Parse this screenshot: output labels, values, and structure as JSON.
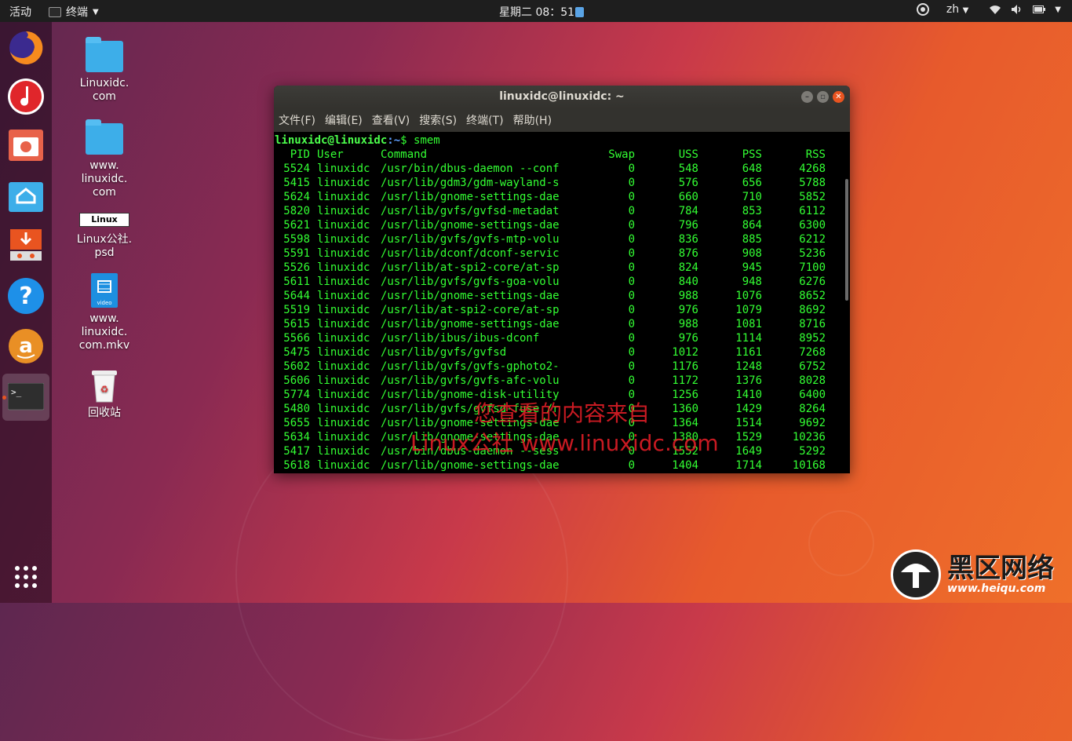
{
  "topbar": {
    "activities": "活动",
    "app_name": "终端",
    "clock": "星期二 08：51",
    "lang": "zh"
  },
  "dock": {
    "items": [
      "firefox-icon",
      "rhythmbox-icon",
      "shotwell-icon",
      "files-icon",
      "software-updater-icon",
      "help-icon",
      "amazon-icon",
      "terminal-icon",
      "show-apps-icon"
    ]
  },
  "desktop": {
    "icons": [
      {
        "label_lines": [
          "Linuxidc.",
          "com"
        ]
      },
      {
        "label_lines": [
          "www.",
          "linuxidc.",
          "com"
        ]
      },
      {
        "label_lines": [
          "Linux公社.",
          "psd"
        ],
        "thumb_text": "Linux"
      },
      {
        "label_lines": [
          "www.",
          "linuxidc.",
          "com.mkv"
        ],
        "thumb_text": "video"
      },
      {
        "label_lines": [
          "回收站"
        ]
      }
    ]
  },
  "terminal": {
    "title": "linuxidc@linuxidc: ~",
    "menu": [
      "文件(F)",
      "编辑(E)",
      "查看(V)",
      "搜索(S)",
      "终端(T)",
      "帮助(H)"
    ],
    "prompt_user": "linuxidc@linuxidc",
    "prompt_path": ":~",
    "prompt_cmd": "$ smem",
    "headers": [
      "PID",
      "User",
      "Command",
      "Swap",
      "USS",
      "PSS",
      "RSS"
    ],
    "rows": [
      [
        "5524",
        "linuxidc",
        "/usr/bin/dbus-daemon --conf",
        "0",
        "548",
        "648",
        "4268"
      ],
      [
        "5415",
        "linuxidc",
        "/usr/lib/gdm3/gdm-wayland-s",
        "0",
        "576",
        "656",
        "5788"
      ],
      [
        "5624",
        "linuxidc",
        "/usr/lib/gnome-settings-dae",
        "0",
        "660",
        "710",
        "5852"
      ],
      [
        "5820",
        "linuxidc",
        "/usr/lib/gvfs/gvfsd-metadat",
        "0",
        "784",
        "853",
        "6112"
      ],
      [
        "5621",
        "linuxidc",
        "/usr/lib/gnome-settings-dae",
        "0",
        "796",
        "864",
        "6300"
      ],
      [
        "5598",
        "linuxidc",
        "/usr/lib/gvfs/gvfs-mtp-volu",
        "0",
        "836",
        "885",
        "6212"
      ],
      [
        "5591",
        "linuxidc",
        "/usr/lib/dconf/dconf-servic",
        "0",
        "876",
        "908",
        "5236"
      ],
      [
        "5526",
        "linuxidc",
        "/usr/lib/at-spi2-core/at-sp",
        "0",
        "824",
        "945",
        "7100"
      ],
      [
        "5611",
        "linuxidc",
        "/usr/lib/gvfs/gvfs-goa-volu",
        "0",
        "840",
        "948",
        "6276"
      ],
      [
        "5644",
        "linuxidc",
        "/usr/lib/gnome-settings-dae",
        "0",
        "988",
        "1076",
        "8652"
      ],
      [
        "5519",
        "linuxidc",
        "/usr/lib/at-spi2-core/at-sp",
        "0",
        "976",
        "1079",
        "8692"
      ],
      [
        "5615",
        "linuxidc",
        "/usr/lib/gnome-settings-dae",
        "0",
        "988",
        "1081",
        "8716"
      ],
      [
        "5566",
        "linuxidc",
        "/usr/lib/ibus/ibus-dconf",
        "0",
        "976",
        "1114",
        "8952"
      ],
      [
        "5475",
        "linuxidc",
        "/usr/lib/gvfs/gvfsd",
        "0",
        "1012",
        "1161",
        "7268"
      ],
      [
        "5602",
        "linuxidc",
        "/usr/lib/gvfs/gvfs-gphoto2-",
        "0",
        "1176",
        "1248",
        "6752"
      ],
      [
        "5606",
        "linuxidc",
        "/usr/lib/gvfs/gvfs-afc-volu",
        "0",
        "1172",
        "1376",
        "8028"
      ],
      [
        "5774",
        "linuxidc",
        "/usr/lib/gnome-disk-utility",
        "0",
        "1256",
        "1410",
        "6400"
      ],
      [
        "5480",
        "linuxidc",
        "/usr/lib/gvfs/gvfsd-fuse /r",
        "0",
        "1360",
        "1429",
        "8264"
      ],
      [
        "5655",
        "linuxidc",
        "/usr/lib/gnome-settings-dae",
        "0",
        "1364",
        "1514",
        "9692"
      ],
      [
        "5634",
        "linuxidc",
        "/usr/lib/gnome-settings-dae",
        "0",
        "1380",
        "1529",
        "10236"
      ],
      [
        "5417",
        "linuxidc",
        "/usr/bin/dbus-daemon --sess",
        "0",
        "1552",
        "1649",
        "5292"
      ],
      [
        "5618",
        "linuxidc",
        "/usr/lib/gnome-settings-dae",
        "0",
        "1404",
        "1714",
        "10168"
      ]
    ]
  },
  "watermark": {
    "line1": "您查看的内容来自",
    "line2": "Linux公社 www.linuxidc.com"
  },
  "brand": {
    "name": "黑区网络",
    "url": "www.heiqu.com"
  }
}
